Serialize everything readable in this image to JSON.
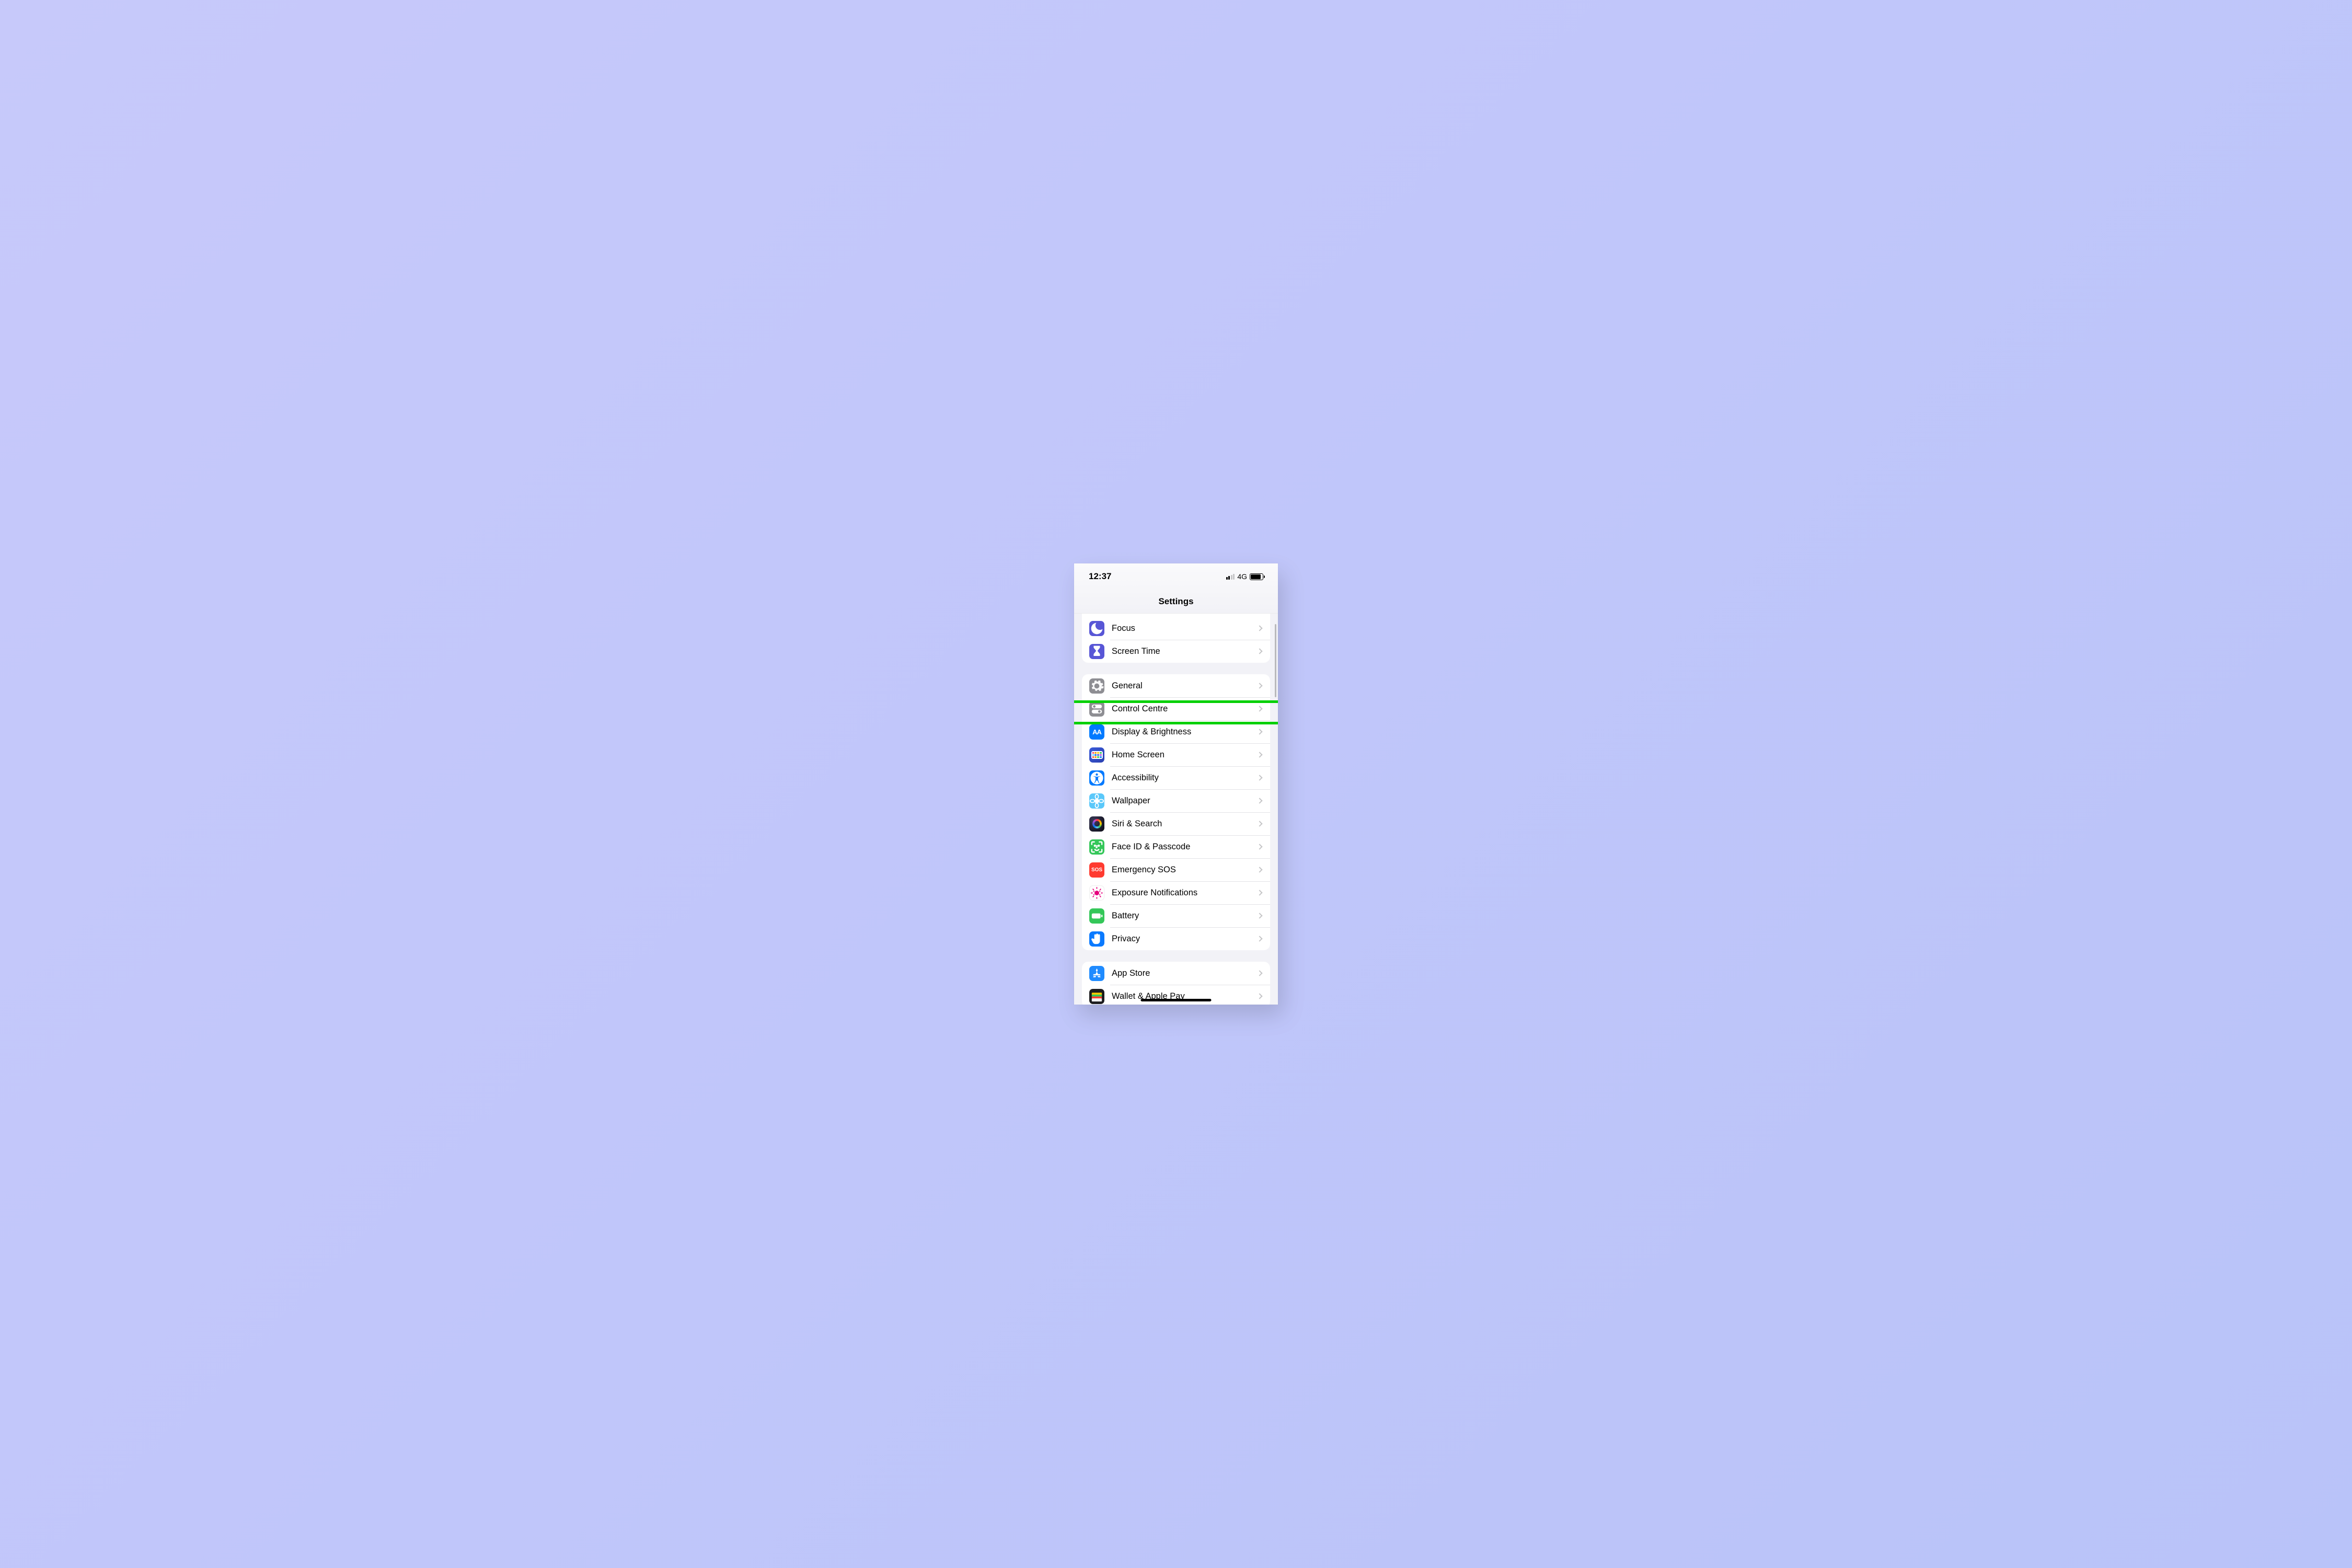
{
  "statusbar": {
    "time": "12:37",
    "network": "4G"
  },
  "nav": {
    "title": "Settings"
  },
  "highlight_target": "control-centre",
  "groups": [
    {
      "id": "g1",
      "partial_top": true,
      "rows": [
        {
          "id": "focus",
          "label": "Focus",
          "icon": "moon-icon"
        },
        {
          "id": "screen-time",
          "label": "Screen Time",
          "icon": "hourglass-icon"
        }
      ]
    },
    {
      "id": "g2",
      "rows": [
        {
          "id": "general",
          "label": "General",
          "icon": "gear-icon"
        },
        {
          "id": "control-centre",
          "label": "Control Centre",
          "icon": "toggles-icon"
        },
        {
          "id": "display-brightness",
          "label": "Display & Brightness",
          "icon": "text-size-icon"
        },
        {
          "id": "home-screen",
          "label": "Home Screen",
          "icon": "app-grid-icon"
        },
        {
          "id": "accessibility",
          "label": "Accessibility",
          "icon": "accessibility-icon"
        },
        {
          "id": "wallpaper",
          "label": "Wallpaper",
          "icon": "flower-icon"
        },
        {
          "id": "siri-search",
          "label": "Siri & Search",
          "icon": "siri-icon"
        },
        {
          "id": "face-id-passcode",
          "label": "Face ID & Passcode",
          "icon": "face-id-icon"
        },
        {
          "id": "emergency-sos",
          "label": "Emergency SOS",
          "icon": "sos-icon"
        },
        {
          "id": "exposure-notifications",
          "label": "Exposure Notifications",
          "icon": "exposure-icon"
        },
        {
          "id": "battery",
          "label": "Battery",
          "icon": "battery-icon"
        },
        {
          "id": "privacy",
          "label": "Privacy",
          "icon": "hand-icon"
        }
      ]
    },
    {
      "id": "g3",
      "rows": [
        {
          "id": "app-store",
          "label": "App Store",
          "icon": "appstore-icon"
        },
        {
          "id": "wallet-pay",
          "label": "Wallet & Apple Pay",
          "icon": "wallet-icon"
        }
      ]
    }
  ]
}
